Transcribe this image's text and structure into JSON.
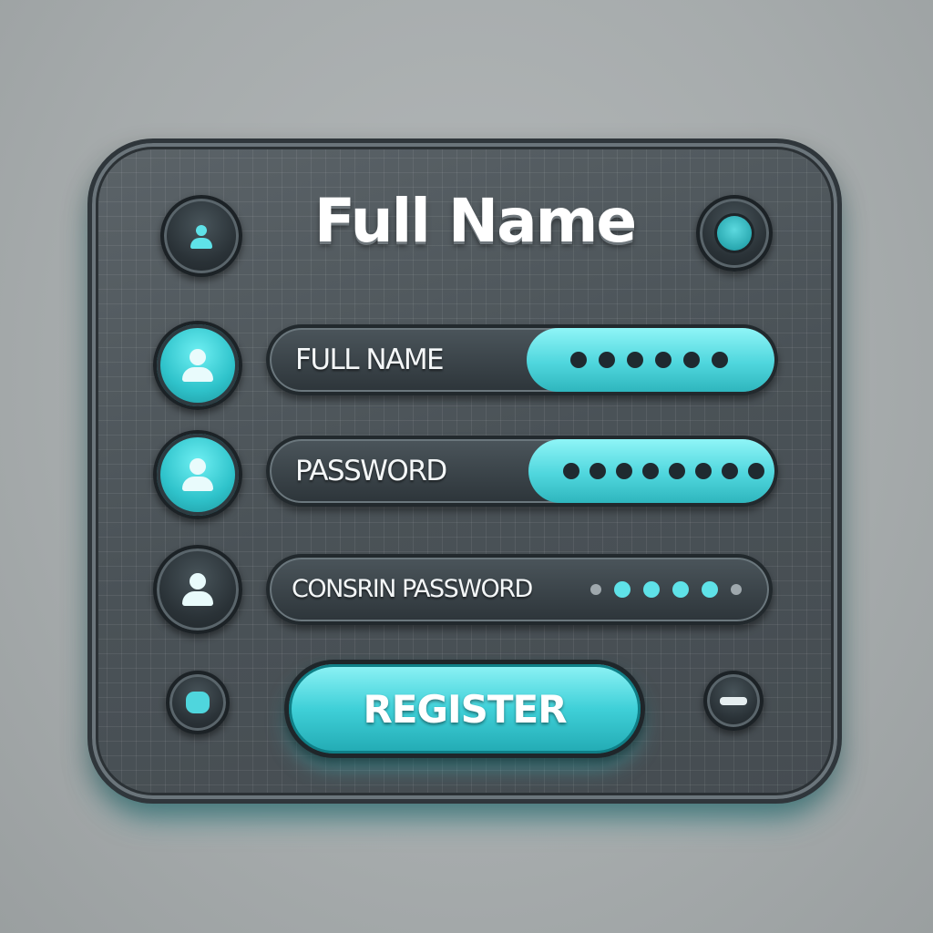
{
  "form": {
    "title": "Full Name",
    "fields": [
      {
        "label": "FULL NAME",
        "masked_dots": 6
      },
      {
        "label": "PASSWORD",
        "masked_dots": 8
      },
      {
        "label": "CONSRIN PASSWORD",
        "masked_dots": 6
      }
    ],
    "register_label": "REGISTER"
  },
  "colors": {
    "accent": "#3fd0d8",
    "panel": "#4d555a",
    "background": "#a6abac"
  },
  "icons": {
    "top_left": "user-icon",
    "top_right": "record-icon",
    "field_icons": [
      "user-icon",
      "user-icon",
      "user-icon"
    ],
    "bottom_left": "pill-icon",
    "bottom_right": "minus-icon"
  }
}
